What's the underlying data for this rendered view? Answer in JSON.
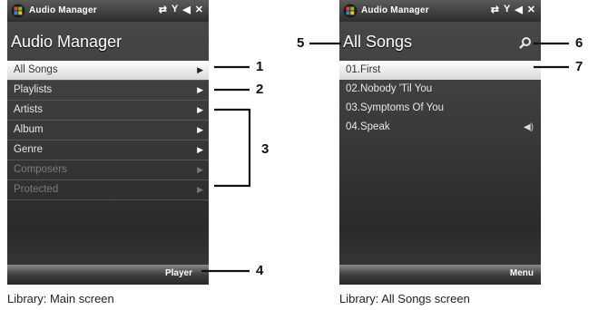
{
  "left_screen": {
    "status_title": "Audio Manager",
    "app_title": "Audio Manager",
    "menu_items": [
      {
        "label": "All Songs",
        "state": "selected"
      },
      {
        "label": "Playlists",
        "state": "normal"
      },
      {
        "label": "Artists",
        "state": "normal"
      },
      {
        "label": "Album",
        "state": "normal"
      },
      {
        "label": "Genre",
        "state": "normal"
      },
      {
        "label": "Composers",
        "state": "disabled"
      },
      {
        "label": "Protected",
        "state": "disabled"
      }
    ],
    "softkey_right": "Player",
    "caption": "Library: Main screen"
  },
  "right_screen": {
    "status_title": "Audio Manager",
    "app_title": "All Songs",
    "songs": [
      {
        "label": "01.First",
        "state": "selected"
      },
      {
        "label": "02.Nobody 'Til You",
        "state": "normal"
      },
      {
        "label": "03.Symptoms Of You",
        "state": "normal"
      },
      {
        "label": "04.Speak",
        "state": "playing"
      }
    ],
    "softkey_right": "Menu",
    "caption": "Library: All Songs screen"
  },
  "callouts": [
    "1",
    "2",
    "3",
    "4",
    "5",
    "6",
    "7"
  ],
  "icons": {
    "start": "windows-start-icon",
    "connectivity": "sync-arrows-icon",
    "signal": "signal-icon",
    "volume": "speaker-icon",
    "close": "close-icon",
    "arrow": "right-triangle-icon",
    "search": "search-icon",
    "playing": "speaker-playing-icon"
  },
  "colors": {
    "screen_bg": "#3a3a3a",
    "highlight": "#ffffff",
    "text": "#e8e8e8"
  }
}
